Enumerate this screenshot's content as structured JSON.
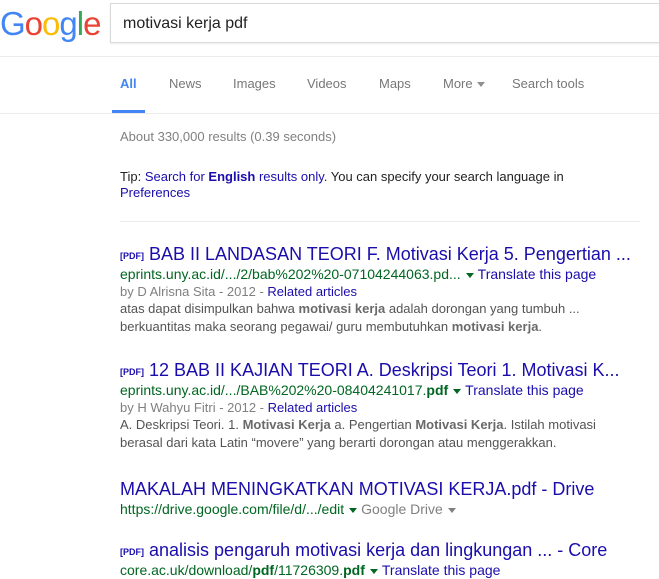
{
  "logo_text": "Google",
  "search": {
    "query": "motivasi kerja pdf"
  },
  "tabs": [
    "All",
    "News",
    "Images",
    "Videos",
    "Maps",
    "More",
    "Search tools"
  ],
  "stats": "About 330,000 results (0.39 seconds)",
  "tip": {
    "prefix": "Tip: ",
    "link1": "Search for ",
    "link_bold": "English",
    "link2": " results only",
    "middle": ". You can specify your search language in ",
    "link3": "Preferences"
  },
  "results": [
    {
      "pdf": "[PDF]",
      "title": "BAB II LANDASAN TEORI F. Motivasi Kerja 5. Pengertian ...",
      "url": "eprints.uny.ac.id/.../2/bab%202%20-07104244063.pd...",
      "translate": "Translate this page",
      "by": "by D Alrisna Sita - 2012 - ",
      "related": "Related articles",
      "snippet1_pre": "atas dapat disimpulkan bahwa ",
      "snippet1_bold": "motivasi kerja",
      "snippet1_post": " adalah dorongan yang tumbuh ...",
      "snippet2_pre": "berkuantitas maka seorang pegawai/ guru membutuhkan ",
      "snippet2_bold": "motivasi kerja",
      "snippet2_post": "."
    },
    {
      "pdf": "[PDF]",
      "title": "12 BAB II KAJIAN TEORI A. Deskripsi Teori 1. Motivasi K...",
      "url": "eprints.uny.ac.id/.../BAB%202%20-08404241017.",
      "url_bold": "pdf",
      "translate": "Translate this page",
      "by": "by H Wahyu Fitri - 2012 - ",
      "related": "Related articles",
      "snippet1_pre": "A. Deskripsi Teori. 1. ",
      "snippet1_bold": "Motivasi Kerja",
      "snippet1_mid": " a. Pengertian ",
      "snippet1_bold2": "Motivasi Kerja",
      "snippet1_post": ". Istilah motivasi",
      "snippet2": "berasal dari kata Latin “movere” yang berarti dorongan atau menggerakkan."
    },
    {
      "title": "MAKALAH MENINGKATKAN MOTIVASI KERJA.pdf - Drive",
      "url": "https://drive.google.com/file/d/.../edit",
      "drive": "Google Drive"
    },
    {
      "pdf": "[PDF]",
      "title": "analisis pengaruh motivasi kerja dan lingkungan ... - Core",
      "url_pre": "core.ac.uk/download/",
      "url_bold": "pdf",
      "url_post": "/11726309.",
      "url_bold2": "pdf",
      "translate": "Translate this page"
    }
  ]
}
